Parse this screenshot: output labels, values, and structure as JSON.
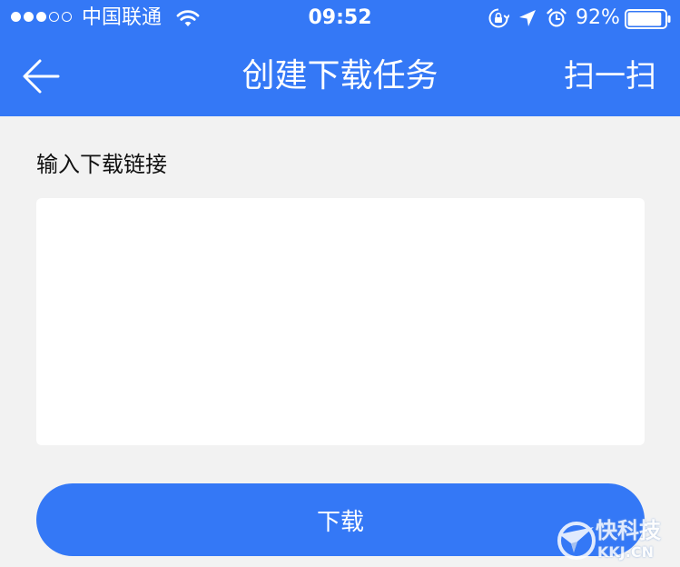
{
  "status_bar": {
    "carrier": "中国联通",
    "time": "09:52",
    "battery_percent": "92%",
    "battery_level": 0.92,
    "signal_bars_filled": 3,
    "signal_bars_total": 5
  },
  "nav": {
    "title": "创建下载任务",
    "scan_label": "扫一扫"
  },
  "form": {
    "label": "输入下载链接",
    "url_value": "",
    "submit_label": "下载"
  },
  "watermark": {
    "name": "快科技",
    "domain": "KKJ.CN"
  },
  "colors": {
    "accent": "#3478f6",
    "background": "#f2f2f2",
    "input_background": "#ffffff"
  },
  "icons": {
    "back": "arrow-left-icon",
    "wifi": "wifi-icon",
    "orientation_lock": "orientation-lock-icon",
    "location": "location-arrow-icon",
    "alarm": "alarm-clock-icon",
    "battery": "battery-icon"
  }
}
